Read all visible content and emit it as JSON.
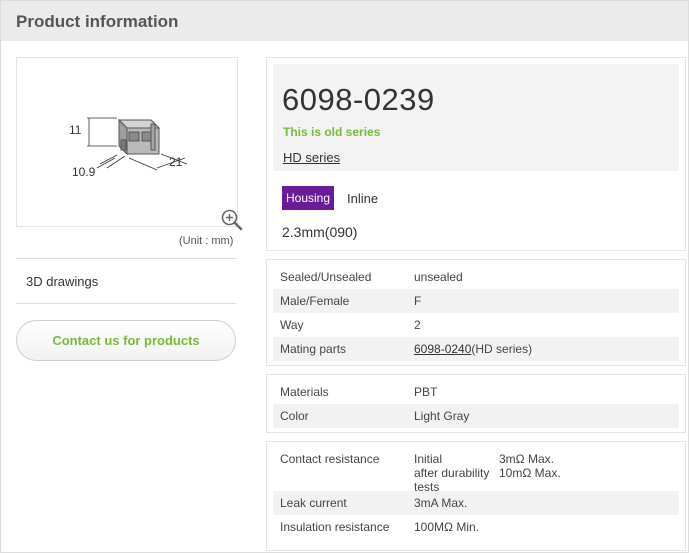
{
  "header": {
    "title": "Product information"
  },
  "left": {
    "unit_label": "(Unit : mm)",
    "dims": {
      "height": "11",
      "width": "10.9",
      "length": "21"
    },
    "drawings_label": "3D drawings",
    "contact_label": "Contact us for products"
  },
  "product": {
    "part_number": "6098-0239",
    "status": "This is old series",
    "series": "HD series",
    "badge": "Housing",
    "type": "Inline",
    "pitch": "2.3mm(090)"
  },
  "specs1": [
    {
      "key": "Sealed/Unsealed",
      "value": "unsealed"
    },
    {
      "key": "Male/Female",
      "value": "F"
    },
    {
      "key": "Way",
      "value": "2"
    },
    {
      "key": "Mating parts",
      "link": "6098-0240",
      "suffix": "(HD series)"
    }
  ],
  "specs2": [
    {
      "key": "Materials",
      "value": "PBT"
    },
    {
      "key": "Color",
      "value": "Light Gray"
    }
  ],
  "specs3": {
    "contact": {
      "key": "Contact resistance",
      "initial_label": "Initial",
      "initial_value": "3mΩ Max.",
      "after_label": "after durability",
      "after_label2": "tests",
      "after_value": "10mΩ Max."
    },
    "leak": {
      "key": "Leak current",
      "value": "3mA Max."
    },
    "insulation": {
      "key": "Insulation resistance",
      "value": "100MΩ Min."
    }
  },
  "colors": {
    "accent_green": "#7ab83c",
    "badge_purple": "#6a1b9a"
  }
}
